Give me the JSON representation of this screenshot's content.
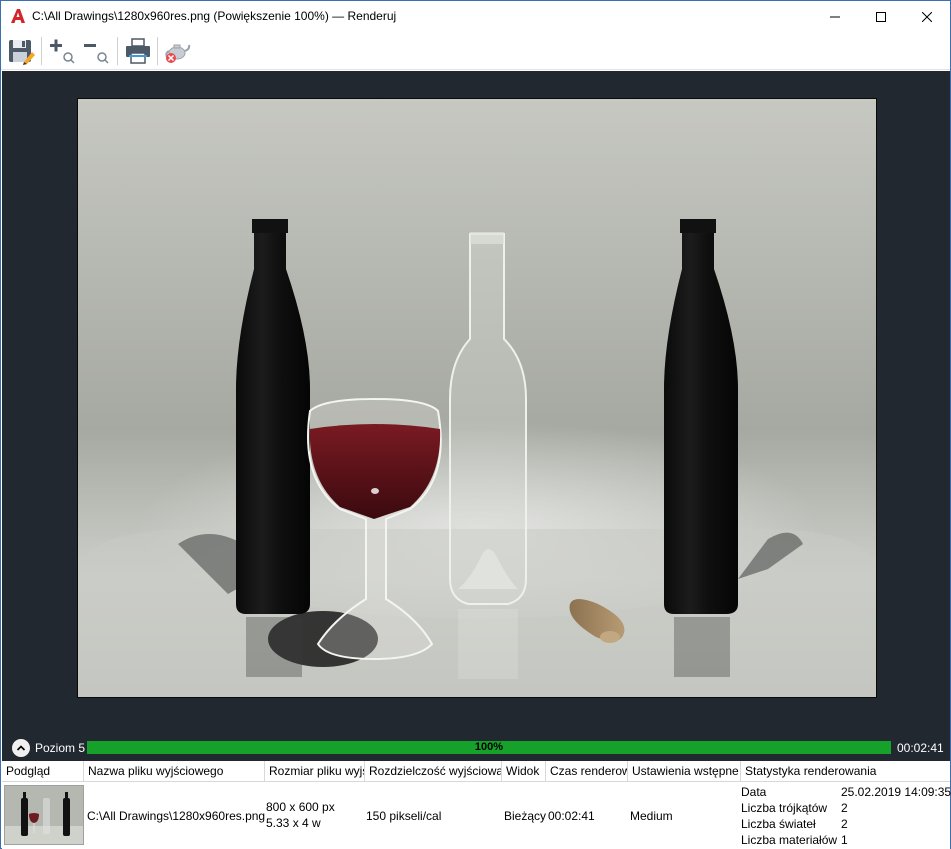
{
  "window": {
    "title": "C:\\All Drawings\\1280x960res.png (Powiększenie 100%) — Renderuj"
  },
  "toolbar": {
    "buttons": [
      "save-icon",
      "zoom-in-icon",
      "zoom-out-icon",
      "print-icon",
      "teapot-cancel-icon"
    ]
  },
  "progress": {
    "level_label": "Poziom 5",
    "percent": 100,
    "percent_text": "100%",
    "elapsed": "00:02:41",
    "fill_color": "#16a22a"
  },
  "history": {
    "columns": [
      "Podgląd",
      "Nazwa pliku wyjściowego",
      "Rozmiar pliku wyjściowego",
      "Rozdzielczość wyjściowa",
      "Widok",
      "Czas renderowania",
      "Ustawienia wstępne",
      "Statystyka renderowania"
    ],
    "row": {
      "filename": "C:\\All Drawings\\1280x960res.png",
      "size_px": "800 x 600 px",
      "size_units": "5.33 x 4 w",
      "resolution": "150 pikseli/cal",
      "view": "Bieżący",
      "render_time": "00:02:41",
      "preset": "Medium",
      "stats": [
        {
          "name": "Data",
          "value": "25.02.2019 14:09:35"
        },
        {
          "name": "Liczba trójkątów",
          "value": "2"
        },
        {
          "name": "Liczba świateł",
          "value": "2"
        },
        {
          "name": "Liczba materiałów",
          "value": "1"
        }
      ]
    }
  },
  "colors": {
    "viewport_bg": "#212830",
    "accent_red": "#d2262b"
  }
}
